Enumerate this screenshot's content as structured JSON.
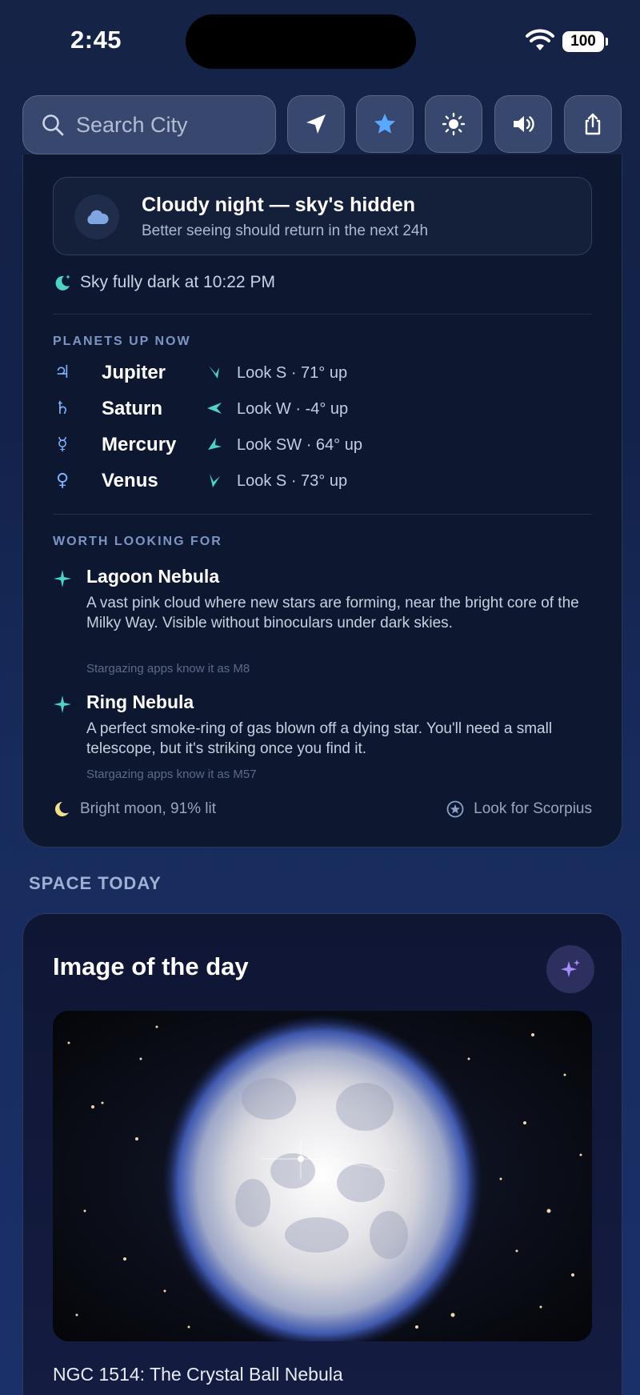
{
  "status_bar": {
    "time": "2:45",
    "battery": "100"
  },
  "toolbar": {
    "search_placeholder": "Search City",
    "buttons": [
      "location-arrow",
      "favorite-star",
      "brightness",
      "sound",
      "share"
    ]
  },
  "tonight": {
    "alert_title": "Cloudy night — sky's hidden",
    "alert_subtitle": "Better seeing should return in the next 24h",
    "dark_time": "Sky fully dark at 10:22 PM",
    "planets_label": "PLANETS UP NOW",
    "planets": [
      {
        "symbol": "♃",
        "name": "Jupiter",
        "direction": "Look S · 71° up"
      },
      {
        "symbol": "♄",
        "name": "Saturn",
        "direction": "Look W · -4° up"
      },
      {
        "symbol": "☿",
        "name": "Mercury",
        "direction": "Look SW · 64° up"
      },
      {
        "symbol": "♀",
        "name": "Venus",
        "direction": "Look S · 73° up"
      }
    ],
    "worth_label": "WORTH LOOKING FOR",
    "objects": [
      {
        "name": "Lagoon Nebula",
        "description": "A vast pink cloud where new stars are forming, near the bright core of the Milky Way. Visible without binoculars under dark skies.",
        "alias": "Stargazing apps know it as M8"
      },
      {
        "name": "Ring Nebula",
        "description": "A perfect smoke-ring of gas blown off a dying star. You'll need a small telescope, but it's striking once you find it.",
        "alias": "Stargazing apps know it as M57"
      }
    ],
    "moon": "Bright moon, 91% lit",
    "constellation": "Look for Scorpius"
  },
  "space_today": {
    "label": "SPACE TODAY",
    "title": "Image of the day",
    "caption": "NGC 1514: The Crystal Ball Nebula"
  },
  "colors": {
    "accent": "#5aa9ff",
    "teal": "#4fd1c5",
    "moon": "#f3e08a",
    "sparkle": "#a78bfa"
  }
}
